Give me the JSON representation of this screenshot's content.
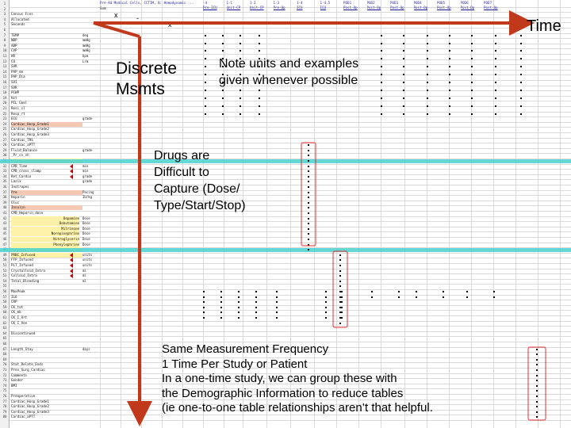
{
  "sheet": {
    "header_text": "Pre-Ad Medical Cells, CCTIM, B: Hemodynamic ...",
    "header_cols": [
      {
        "label": "-4",
        "sub": "Pre-ICU"
      },
      {
        "label": "1-1",
        "sub": "Unit-CP"
      },
      {
        "label": "1-2",
        "sub": "Unit-CP"
      },
      {
        "label": "1-3",
        "sub": "Pre-Op"
      },
      {
        "label": "1-4",
        "sub": "ICU"
      },
      {
        "label": "1-4.5",
        "sub": "ICU"
      },
      {
        "label": "POD1",
        "sub": "Post-Op"
      },
      {
        "label": "POD2",
        "sub": "Post-Op"
      },
      {
        "label": "POD3",
        "sub": "Post-Op"
      },
      {
        "label": "POD4",
        "sub": "Post-Op"
      },
      {
        "label": "POD5",
        "sub": "Post-Op"
      },
      {
        "label": "POD6",
        "sub": "Post-Op"
      },
      {
        "label": "POD7",
        "sub": "Post-Op"
      }
    ],
    "top_labels": [
      "Sum",
      "Pre-Op",
      "Intra"
    ],
    "top_marks": [
      "x",
      "-",
      "x"
    ],
    "rows": [
      {
        "n": "1",
        "label": "",
        "unit": ""
      },
      {
        "n": "2",
        "label": "",
        "unit": ""
      },
      {
        "n": "3",
        "label": "Census Fcns",
        "unit": ""
      },
      {
        "n": "4",
        "label": "Allocated",
        "unit": ""
      },
      {
        "n": "5",
        "label": "Seconds",
        "unit": ""
      },
      {
        "n": "6",
        "label": "",
        "unit": ""
      },
      {
        "n": "7",
        "label": "TEMP",
        "unit": "deg"
      },
      {
        "n": "8",
        "label": "NBP",
        "unit": "mmHg"
      },
      {
        "n": "9",
        "label": "ABP",
        "unit": "mmHg"
      },
      {
        "n": "10",
        "label": "CVP",
        "unit": "mmHg"
      },
      {
        "n": "11",
        "label": "HR",
        "unit": "bpm"
      },
      {
        "n": "12",
        "label": "CO",
        "unit": "L/m"
      },
      {
        "n": "13",
        "label": "SVR",
        "unit": ""
      },
      {
        "n": "14",
        "label": "PAP_mn",
        "unit": ""
      },
      {
        "n": "15",
        "label": "PAP_Dia",
        "unit": ""
      },
      {
        "n": "16",
        "label": "SVI",
        "unit": ""
      },
      {
        "n": "17",
        "label": "SVR",
        "unit": ""
      },
      {
        "n": "18",
        "label": "PCWP",
        "unit": ""
      },
      {
        "n": "19",
        "label": "Hct",
        "unit": ""
      },
      {
        "n": "20",
        "label": "PIL Gael",
        "unit": ""
      },
      {
        "n": "21",
        "label": "Resi_sl",
        "unit": ""
      },
      {
        "n": "22",
        "label": "Resp_rt",
        "unit": ""
      },
      {
        "n": "23",
        "label": "ECG",
        "unit": "grade"
      },
      {
        "n": "24",
        "label": "Cardiac_Hosp_Grade1",
        "unit": ""
      },
      {
        "n": "25",
        "label": "Cardiac_Hosp_Grade2",
        "unit": ""
      },
      {
        "n": "26",
        "label": "Cardiac_Hosp_Grade3",
        "unit": ""
      },
      {
        "n": "27",
        "label": "Cardiac_TRS",
        "unit": ""
      },
      {
        "n": "28",
        "label": "Cardiac_aPTT",
        "unit": ""
      },
      {
        "n": "29",
        "label": "Fluid_Balance",
        "unit": "grade"
      },
      {
        "n": "30",
        "label": "_Pr_cv_sh",
        "unit": ""
      },
      {
        "n": "31",
        "label": "",
        "unit": ""
      },
      {
        "n": "32",
        "label": "CPB_Time",
        "unit": "min"
      },
      {
        "n": "33",
        "label": "CPB_cross_clamp",
        "unit": "min"
      },
      {
        "n": "34",
        "label": "Ret_Cardio",
        "unit": "grade"
      },
      {
        "n": "35",
        "label": "Lasix",
        "unit": "grade"
      },
      {
        "n": "36",
        "label": "Inotropes",
        "unit": ""
      },
      {
        "n": "37",
        "label": "Pre",
        "unit": "Pacing"
      },
      {
        "n": "38",
        "label": "Heparin",
        "unit": "IU/kg"
      },
      {
        "n": "39",
        "label": "Gluc",
        "unit": ""
      },
      {
        "n": "40",
        "label": "Insulin",
        "unit": ""
      },
      {
        "n": "41",
        "label": "CPB_Heparin_dose",
        "unit": ""
      },
      {
        "n": "42",
        "label": "Dopamine",
        "unit": "Dose"
      },
      {
        "n": "43",
        "label": "Dobutamine",
        "unit": "Dose"
      },
      {
        "n": "44",
        "label": "Milrinone",
        "unit": "Dose"
      },
      {
        "n": "45",
        "label": "Norepinephrine",
        "unit": "Dose"
      },
      {
        "n": "46",
        "label": "Nitroglycerin",
        "unit": "Dose"
      },
      {
        "n": "47",
        "label": "Phenylephrine",
        "unit": "Dose"
      },
      {
        "n": "48",
        "label": "",
        "unit": ""
      },
      {
        "n": "49",
        "label": "PRBC_Infused",
        "unit": "units"
      },
      {
        "n": "50",
        "label": "FFP_Infused",
        "unit": "units"
      },
      {
        "n": "51",
        "label": "PLT_Infused",
        "unit": "units"
      },
      {
        "n": "52",
        "label": "Crystalloid_Intra",
        "unit": "ml"
      },
      {
        "n": "53",
        "label": "Colloid_Intra",
        "unit": "ml"
      },
      {
        "n": "54",
        "label": "Total_Bleeding",
        "unit": "ml"
      },
      {
        "n": "55",
        "label": "",
        "unit": ""
      },
      {
        "n": "56",
        "label": "MaxPeak",
        "unit": ""
      },
      {
        "n": "57",
        "label": "IL6",
        "unit": ""
      },
      {
        "n": "58",
        "label": "CRP",
        "unit": ""
      },
      {
        "n": "59",
        "label": "CK_tot",
        "unit": ""
      },
      {
        "n": "60",
        "label": "CK_mb",
        "unit": ""
      },
      {
        "n": "61",
        "label": "CK_I_Art",
        "unit": ""
      },
      {
        "n": "62",
        "label": "CK_I_Ven",
        "unit": ""
      },
      {
        "n": "63",
        "label": "",
        "unit": ""
      },
      {
        "n": "64",
        "label": "Discontinued",
        "unit": ""
      },
      {
        "n": "65",
        "label": "",
        "unit": ""
      },
      {
        "n": "66",
        "label": "",
        "unit": ""
      },
      {
        "n": "67",
        "label": "Length_Stay",
        "unit": "days"
      },
      {
        "n": "68",
        "label": "",
        "unit": ""
      },
      {
        "n": "69",
        "label": "",
        "unit": ""
      },
      {
        "n": "70",
        "label": "Stat_Relate_Ends",
        "unit": ""
      },
      {
        "n": "71",
        "label": "Prev_Surg_Cardiac",
        "unit": ""
      },
      {
        "n": "72",
        "label": "Comments",
        "unit": ""
      },
      {
        "n": "73",
        "label": "Gender",
        "unit": ""
      },
      {
        "n": "74",
        "label": "BMI",
        "unit": ""
      },
      {
        "n": "75",
        "label": "",
        "unit": ""
      },
      {
        "n": "76",
        "label": "Preoperative",
        "unit": ""
      },
      {
        "n": "77",
        "label": "Cardiac_Hosp_Grade1",
        "unit": ""
      },
      {
        "n": "78",
        "label": "Cardiac_Hosp_Grade2",
        "unit": ""
      },
      {
        "n": "79",
        "label": "Cardiac_Hosp_Grade3",
        "unit": ""
      },
      {
        "n": "80",
        "label": "Cardiac_aPTT",
        "unit": ""
      }
    ]
  },
  "annotations": {
    "time": "Time",
    "discrete_line1": "Discrete",
    "discrete_line2": "Msmts",
    "note_line1": "Note units and examples",
    "note_line2": "given whenever possible",
    "drugs_line1": "Drugs are",
    "drugs_line2": "Difficult to",
    "drugs_line3": "Capture (Dose/",
    "drugs_line4": "Type/Start/Stop)",
    "same_line1": "Same Measurement Frequency",
    "same_line2": "1 Time Per Study or Patient",
    "same_line3": "In a one-time study, we can group these with",
    "same_line4": "the Demographic Information to reduce tables",
    "same_line5": "(ie one-to-one table relationships aren’t that helpful."
  },
  "colors": {
    "arrow": "#c0391b",
    "teal": "#48d1cc",
    "header_text": "#1a1a9c",
    "highlight_pink": "#f6c8b4",
    "highlight_yellow": "#fff2a8"
  }
}
